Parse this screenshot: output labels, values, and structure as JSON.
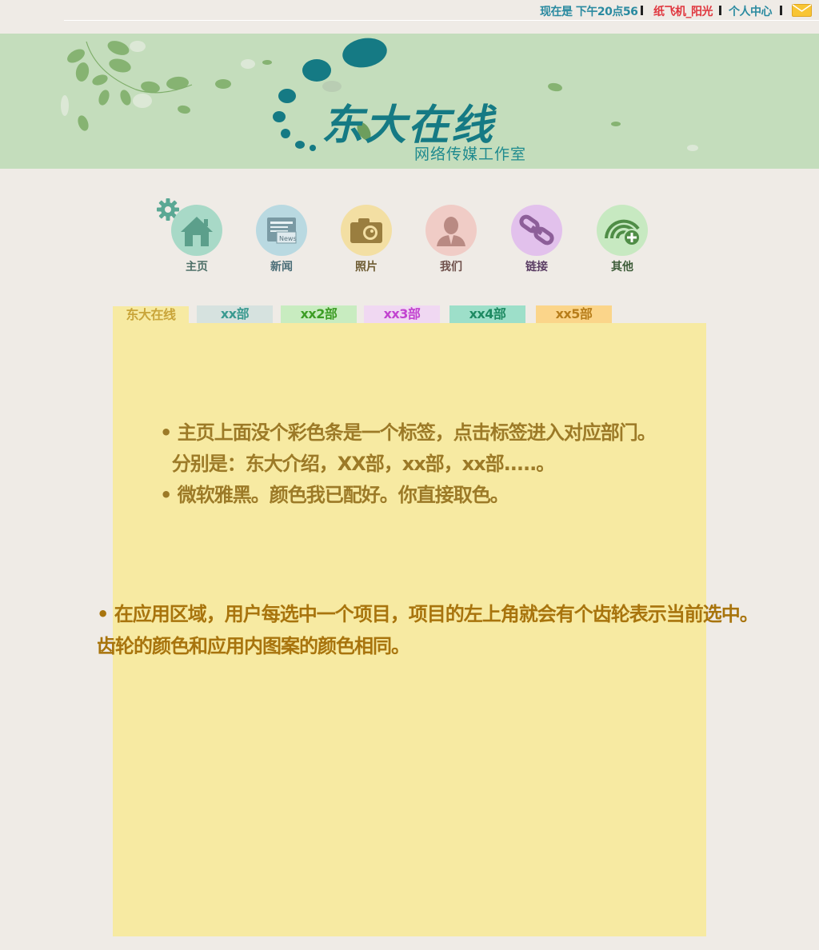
{
  "topbar": {
    "time_text": "现在是 下午20点56",
    "username": "纸飞机_阳光",
    "personal_center": "个人中心",
    "mail_icon": "mail-envelope-icon"
  },
  "banner": {
    "title": "东大在线",
    "subtitle": "网络传媒工作室",
    "colors": {
      "background": "#c4ddbc",
      "title": "#157a84"
    }
  },
  "nav": {
    "items": [
      {
        "label": "主页",
        "icon": "home-icon",
        "color": "#a8d9c7",
        "label_color": "#4e7068"
      },
      {
        "label": "新闻",
        "icon": "news-icon",
        "color": "#b9d9e1",
        "label_color": "#4b6e78"
      },
      {
        "label": "照片",
        "icon": "camera-icon",
        "color": "#f3dfa3",
        "label_color": "#6e5c33"
      },
      {
        "label": "我们",
        "icon": "person-icon",
        "color": "#f0ccc6",
        "label_color": "#6e4f4a"
      },
      {
        "label": "链接",
        "icon": "link-icon",
        "color": "#e2c1ec",
        "label_color": "#5c3f65"
      },
      {
        "label": "其他",
        "icon": "add-signal-icon",
        "color": "#c7e9c1",
        "label_color": "#3f5d3a"
      }
    ],
    "selected_indicator": "gear-icon"
  },
  "tabs": [
    {
      "label": "东大在线",
      "bg": "#f7eaa2",
      "color": "#c9a53a"
    },
    {
      "label": "xx部",
      "bg": "#d6e2df",
      "color": "#3a9a90"
    },
    {
      "label": "xx2部",
      "bg": "#c8ecc0",
      "color": "#3d9d25"
    },
    {
      "label": "xx3部",
      "bg": "#f0d8f2",
      "color": "#c243d0"
    },
    {
      "label": "xx4部",
      "bg": "#9ddfc9",
      "color": "#1e8a62"
    },
    {
      "label": "xx5部",
      "bg": "#fbd58a",
      "color": "#b87e1b"
    }
  ],
  "content": {
    "line1": "• 主页上面没个彩色条是一个标签，点击标签进入对应部门。",
    "line2": "  分别是：东大介绍，XX部，xx部，xx部.....。",
    "line3": "• 微软雅黑。颜色我已配好。你直接取色。",
    "line4": "• 在应用区域，用户每选中一个项目，项目的左上角就会有个齿轮表示当前选中。",
    "line5": "齿轮的颜色和应用内图案的颜色相同。"
  }
}
